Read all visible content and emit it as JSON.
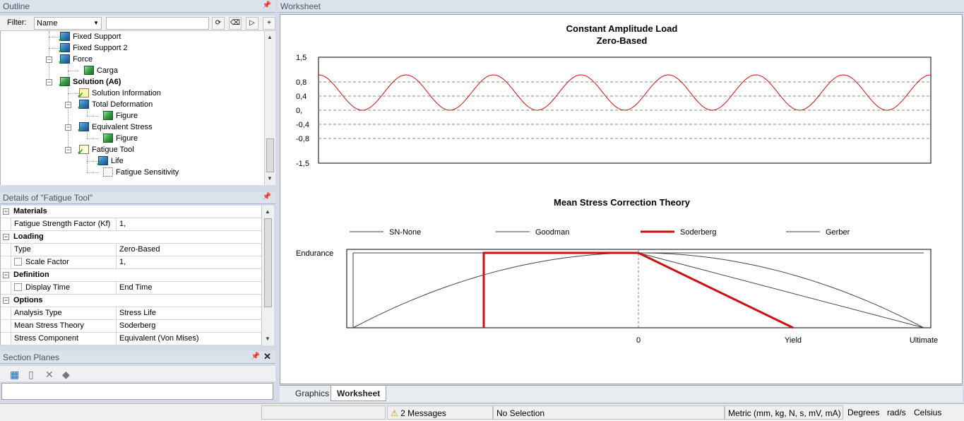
{
  "outline": {
    "title": "Outline",
    "filter_label": "Filter:",
    "filter_value": "Name",
    "tree": [
      {
        "label": "Fixed Support",
        "icon": "boundary-icon"
      },
      {
        "label": "Fixed Support 2",
        "icon": "boundary-icon"
      },
      {
        "label": "Force",
        "icon": "force-icon"
      },
      {
        "label": "Carga",
        "icon": "figure-icon"
      },
      {
        "label": "Solution (A6)",
        "icon": "solution-icon"
      },
      {
        "label": "Solution Information",
        "icon": "solution-info-icon"
      },
      {
        "label": "Total Deformation",
        "icon": "result-icon"
      },
      {
        "label": "Figure",
        "icon": "figure-icon"
      },
      {
        "label": "Equivalent Stress",
        "icon": "result-icon"
      },
      {
        "label": "Figure",
        "icon": "figure-icon"
      },
      {
        "label": "Fatigue Tool",
        "icon": "fatigue-tool-icon"
      },
      {
        "label": "Life",
        "icon": "result-icon"
      },
      {
        "label": "Fatigue Sensitivity",
        "icon": "sensitivity-icon"
      }
    ]
  },
  "details": {
    "title": "Details of \"Fatigue Tool\"",
    "rows": [
      {
        "type": "cat",
        "label": "Materials"
      },
      {
        "type": "prop",
        "key": "Fatigue Strength Factor (Kf)",
        "value": "1,"
      },
      {
        "type": "cat",
        "label": "Loading"
      },
      {
        "type": "prop",
        "key": "Type",
        "value": "Zero-Based"
      },
      {
        "type": "prop",
        "key": "Scale Factor",
        "value": "1,",
        "checkbox": true
      },
      {
        "type": "cat",
        "label": "Definition"
      },
      {
        "type": "prop",
        "key": "Display Time",
        "value": "End Time",
        "checkbox": true
      },
      {
        "type": "cat",
        "label": "Options"
      },
      {
        "type": "prop",
        "key": "Analysis Type",
        "value": "Stress Life"
      },
      {
        "type": "prop",
        "key": "Mean Stress Theory",
        "value": "Soderberg"
      },
      {
        "type": "prop",
        "key": "Stress Component",
        "value": "Equivalent (Von Mises)"
      }
    ]
  },
  "section_planes": {
    "title": "Section Planes"
  },
  "worksheet": {
    "title": "Worksheet",
    "tabs": [
      "Graphics",
      "Worksheet"
    ],
    "active_tab": "Worksheet"
  },
  "status": {
    "messages": "2 Messages",
    "selection": "No Selection",
    "units": "Metric (mm, kg, N, s, mV, mA)",
    "angle": "Degrees",
    "rate": "rad/s",
    "temp": "Celsius"
  },
  "colors": {
    "accent_red": "#cc1111",
    "pane_header": "#dbe2ec"
  },
  "chart_data": [
    {
      "type": "line",
      "title": "Constant Amplitude Load",
      "subtitle": "Zero-Based",
      "y_ticks": [
        "1,5",
        "0,8",
        "0,4",
        "0,",
        "-0,4",
        "-0,8",
        "-1,5"
      ],
      "ylim": [
        -1.5,
        1.5
      ],
      "grid": "dashed horizontal at ±0.4, ±0.8",
      "series": [
        {
          "color": "#cc1111",
          "cycles": 7,
          "min": 0,
          "max": 1
        }
      ]
    },
    {
      "type": "line",
      "title": "Mean Stress Correction Theory",
      "legend": [
        {
          "name": "SN-None",
          "style": "thin"
        },
        {
          "name": "Goodman",
          "style": "thin"
        },
        {
          "name": "Soderberg",
          "style": "thick-red"
        },
        {
          "name": "Gerber",
          "style": "thin"
        }
      ],
      "ylabel": "Endurance",
      "x_ticks": [
        "0",
        "Yield",
        "Ultimate"
      ]
    }
  ]
}
